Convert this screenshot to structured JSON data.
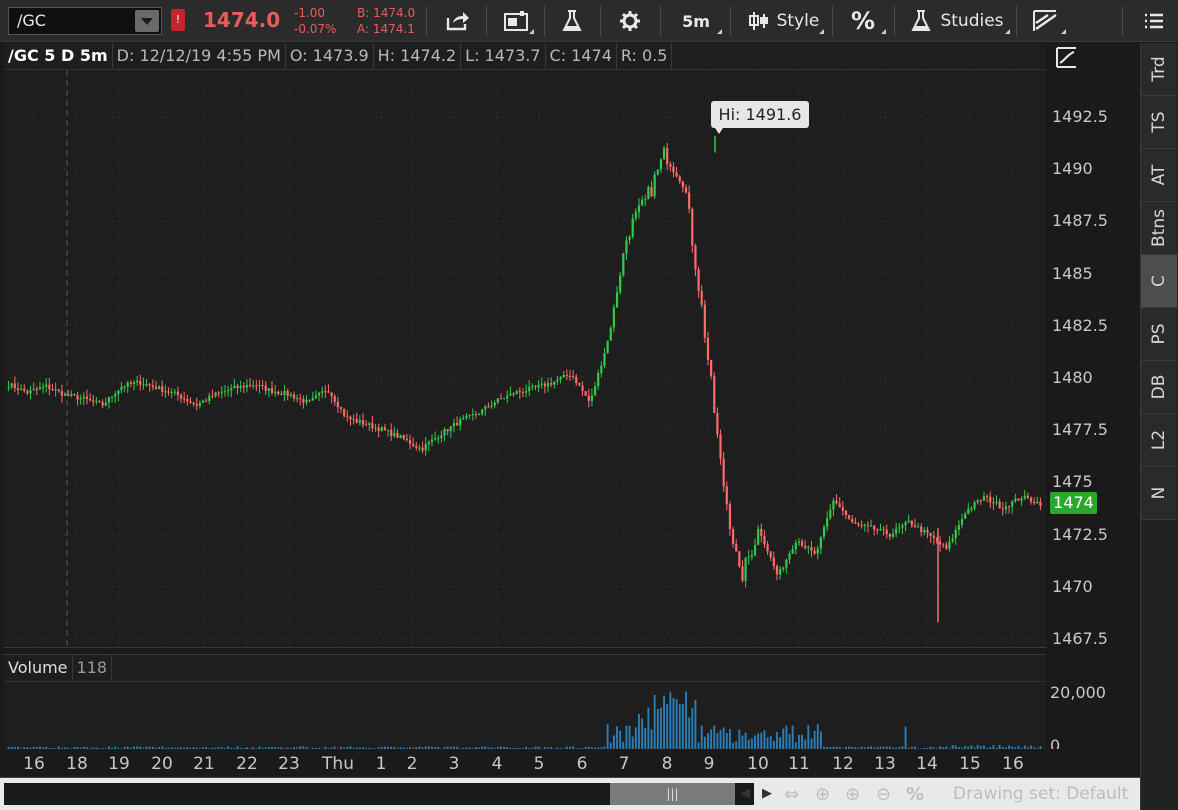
{
  "toolbar": {
    "symbol": "/GC",
    "last_price": "1474.0",
    "change": "-1.00",
    "change_pct": "-0.07%",
    "bid": "B: 1474.0",
    "ask": "A: 1474.1",
    "interval_label": "5m",
    "style_label": "Style",
    "percent_label": "%",
    "studies_label": "Studies",
    "accent_red": "#ec5b5b",
    "accent_green": "#29a82e"
  },
  "info_bar": {
    "title": "/GC 5 D 5m",
    "date": "D: 12/12/19 4:55 PM",
    "open": "O: 1473.9",
    "high": "H: 1474.2",
    "low": "L: 1473.7",
    "close": "C: 1474",
    "range": "R: 0.5"
  },
  "price_axis": {
    "ticks": [
      "1492.5",
      "1490",
      "1487.5",
      "1485",
      "1482.5",
      "1480",
      "1477.5",
      "1475",
      "1472.5",
      "1470",
      "1467.5"
    ],
    "last_tag": "1474"
  },
  "annotation": {
    "hi_label": "Hi: 1491.6"
  },
  "volume": {
    "title": "Volume",
    "value": "118",
    "ticks": [
      "20,000",
      "0"
    ]
  },
  "time_axis": {
    "labels": [
      "16",
      "18",
      "19",
      "20",
      "21",
      "22",
      "23",
      "Thu",
      "1",
      "2",
      "3",
      "4",
      "5",
      "6",
      "7",
      "8",
      "9",
      "10",
      "11",
      "12",
      "13",
      "14",
      "15",
      "16"
    ]
  },
  "side_tabs": [
    "Trd",
    "TS",
    "AT",
    "Btns",
    "C",
    "PS",
    "DB",
    "L2",
    "N"
  ],
  "bottom_bar": {
    "drawing_set": "Drawing set: Default"
  },
  "chart_data": {
    "type": "candlestick",
    "title": "/GC 5 D 5m",
    "ylim": [
      1467.5,
      1493.5
    ],
    "x": [
      "16",
      "18",
      "19",
      "20",
      "21",
      "22",
      "23",
      "Thu",
      "1",
      "2",
      "3",
      "4",
      "5",
      "6",
      "7",
      "8",
      "9",
      "10",
      "11",
      "12",
      "13",
      "14",
      "15",
      "16"
    ],
    "close_path": [
      1479.7,
      1479.3,
      1479.6,
      1479.2,
      1479.0,
      1478.7,
      1479.6,
      1479.8,
      1479.5,
      1479.2,
      1478.7,
      1479.2,
      1479.5,
      1479.7,
      1479.4,
      1479.2,
      1478.8,
      1479.5,
      1478.1,
      1477.8,
      1477.5,
      1477.1,
      1476.6,
      1477.3,
      1477.9,
      1478.3,
      1478.9,
      1479.3,
      1479.5,
      1479.8,
      1480.2,
      1478.8,
      1482.0,
      1487.0,
      1488.5,
      1490.8,
      1489.5,
      1483.0,
      1475.5,
      1470.3,
      1472.8,
      1470.5,
      1472.3,
      1471.5,
      1474.2,
      1473.0,
      1472.8,
      1472.5,
      1473.1,
      1472.5,
      1471.8,
      1473.6,
      1474.3,
      1473.8,
      1474.3,
      1474.0
    ],
    "hi": 1491.6,
    "lo": 1468.3,
    "last": 1474,
    "volume_max_label": 20000
  }
}
